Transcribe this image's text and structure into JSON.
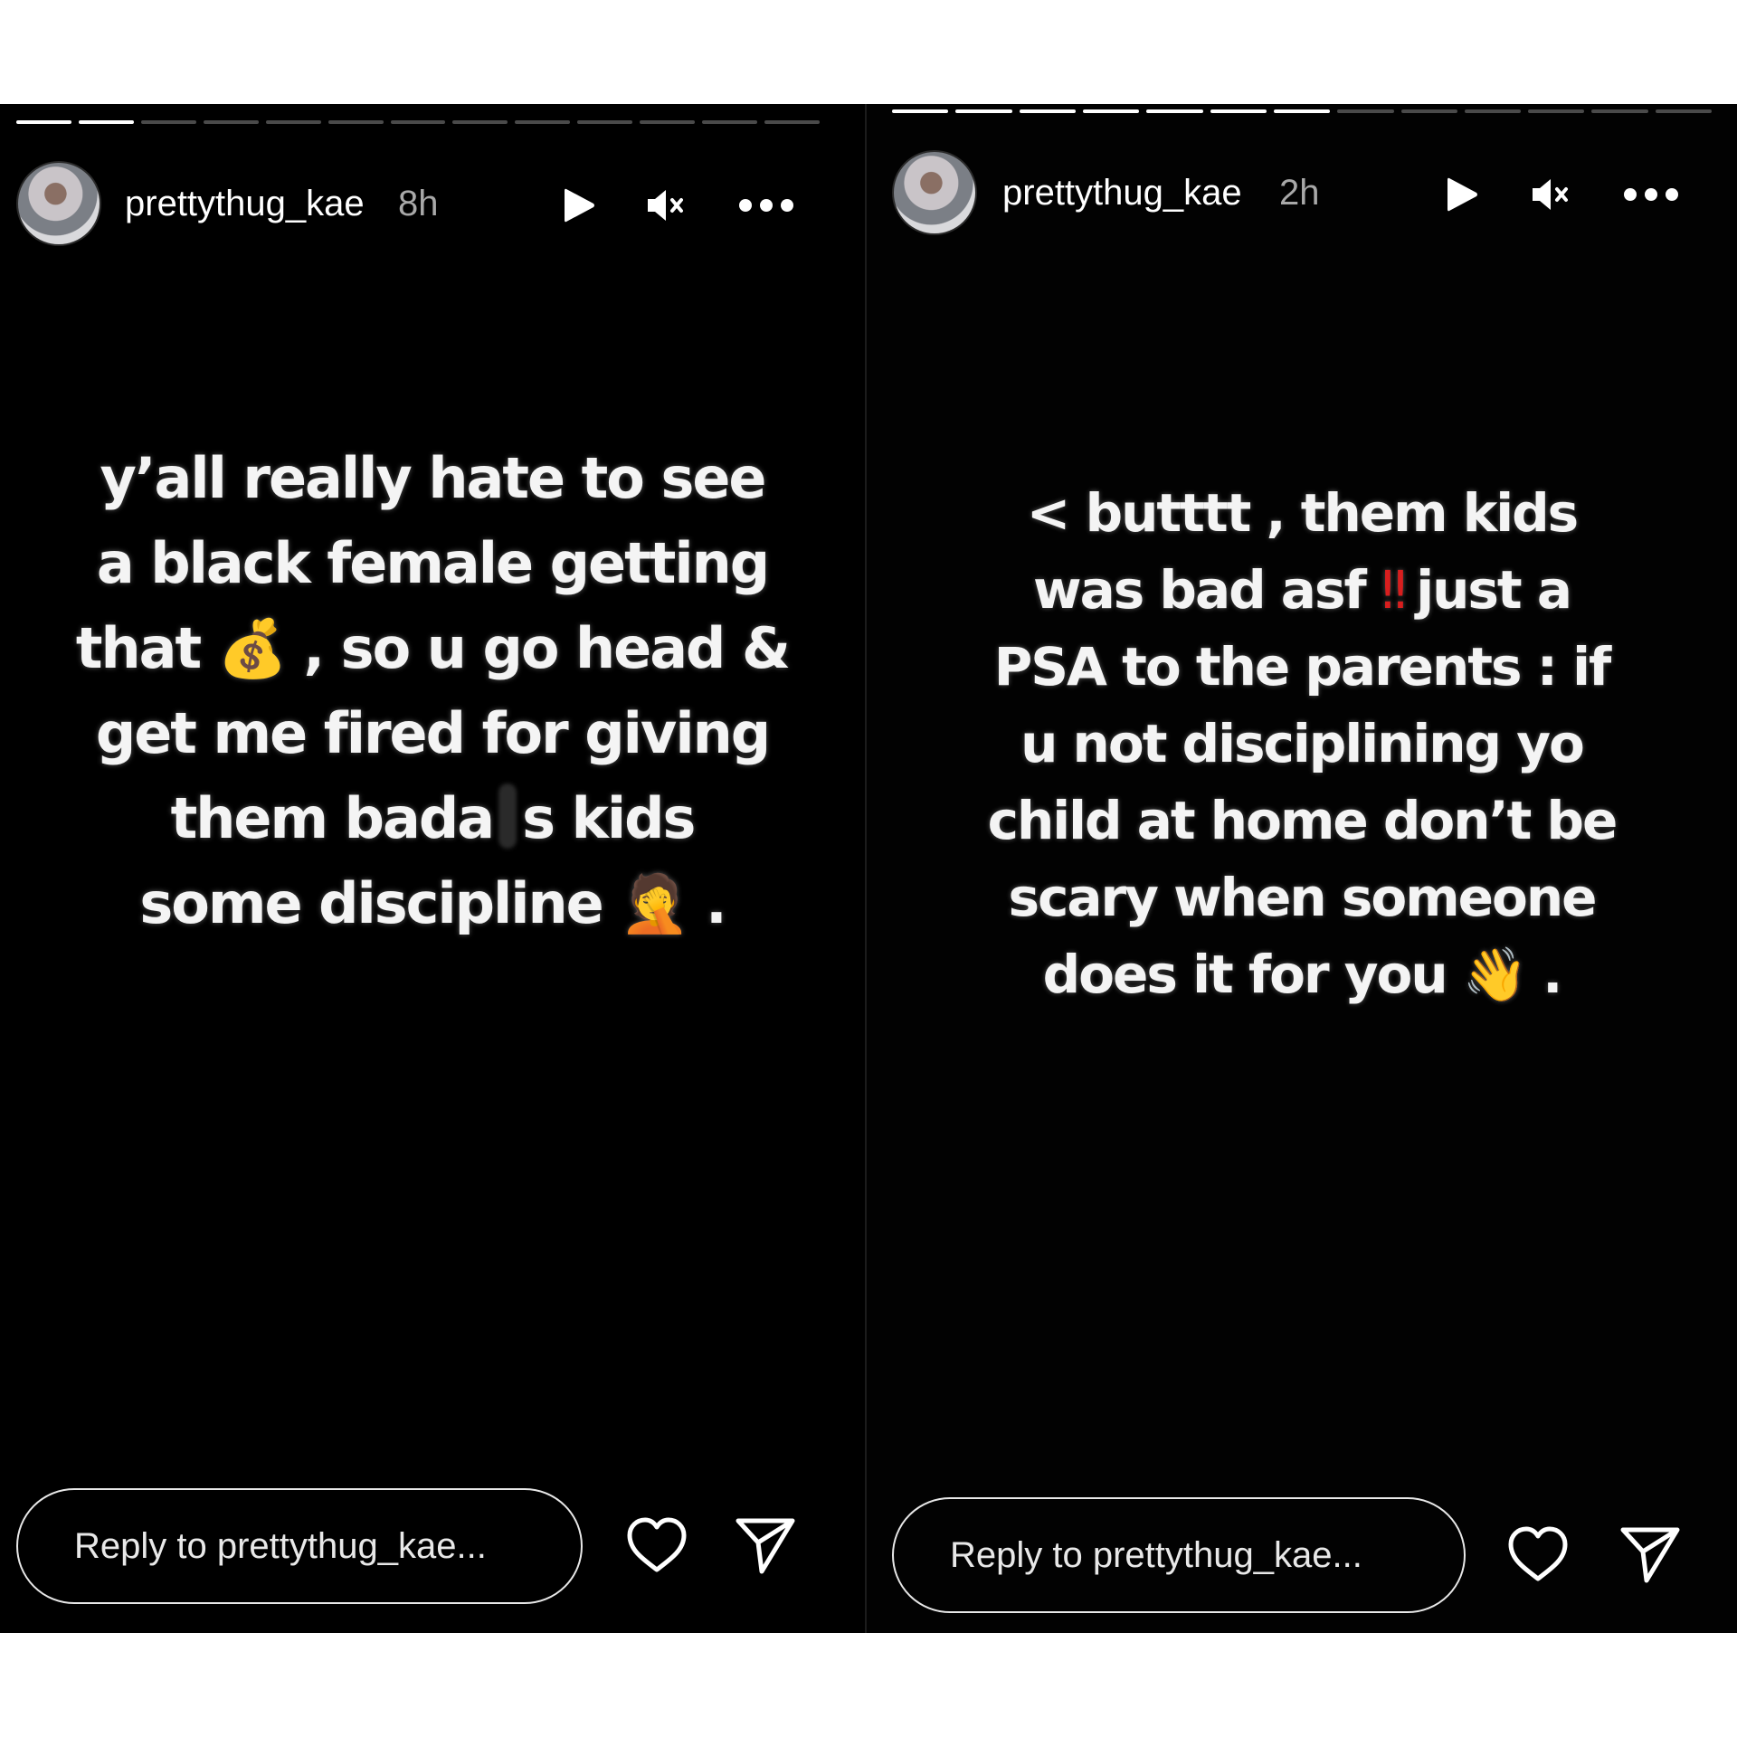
{
  "stories": [
    {
      "username": "prettythug_kae",
      "time": "8h",
      "progress": {
        "segments": 13,
        "completed": 2
      },
      "caption_lines": [
        [
          "y’all really hate to see"
        ],
        [
          "a black female getting"
        ],
        [
          "that ",
          {
            "emoji": "💰",
            "name": "moneybag"
          },
          " , so u go head &"
        ],
        [
          "get me fired for giving"
        ],
        [
          "them bada",
          {
            "redacted": true
          },
          "s kids"
        ],
        [
          "some discipline ",
          {
            "emoji": "🤦",
            "name": "facepalm"
          },
          " ."
        ]
      ],
      "reply_placeholder": "Reply to prettythug_kae..."
    },
    {
      "username": "prettythug_kae",
      "time": "2h",
      "progress": {
        "segments": 13,
        "completed": 7
      },
      "caption_lines": [
        [
          "< butttt , them kids"
        ],
        [
          "was bad asf ",
          {
            "emoji": "‼",
            "name": "bangbang"
          },
          " just a"
        ],
        [
          "PSA to the parents : if"
        ],
        [
          "u not disciplining yo"
        ],
        [
          "child at home don’t be"
        ],
        [
          "scary when someone"
        ],
        [
          "does it for you ",
          {
            "emoji": "👋",
            "name": "wave"
          },
          " ."
        ]
      ],
      "reply_placeholder": "Reply to prettythug_kae..."
    }
  ],
  "icons": [
    "play-icon",
    "mute-icon",
    "more-icon",
    "heart-icon",
    "send-icon"
  ],
  "colors": {
    "background": "#000000",
    "text": "#ffffff",
    "muted_text": "#a8a8a8",
    "progress_track": "#4a4a4a"
  }
}
